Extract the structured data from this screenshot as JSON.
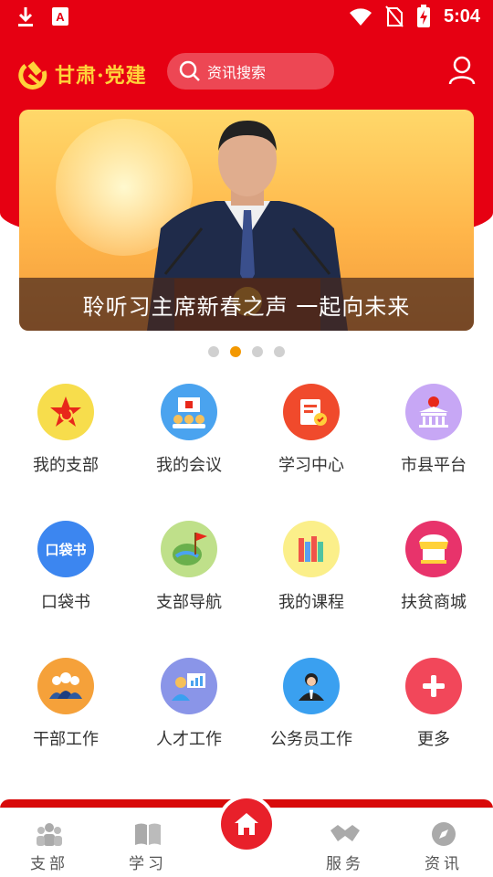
{
  "status_bar": {
    "time": "5:04"
  },
  "header": {
    "brand_name": "甘肃·党建",
    "search_placeholder": "资讯搜索"
  },
  "banner": {
    "caption": "聆听习主席新春之声 一起向未来",
    "slide_count": 4,
    "active_slide": 2
  },
  "grid_items": [
    {
      "label": "我的支部",
      "icon": "party-star-icon",
      "color": "#f7dd4c"
    },
    {
      "label": "我的会议",
      "icon": "meeting-icon",
      "color": "#4aa3ef"
    },
    {
      "label": "学习中心",
      "icon": "study-center-icon",
      "color": "#f04a2c"
    },
    {
      "label": "市县平台",
      "icon": "government-building-icon",
      "color": "#c7a7f5"
    },
    {
      "label": "口袋书",
      "icon": "pocket-book-icon",
      "color": "#3c86f0"
    },
    {
      "label": "支部导航",
      "icon": "map-flag-icon",
      "color": "#bfe08a"
    },
    {
      "label": "我的课程",
      "icon": "books-icon",
      "color": "#fbef8a"
    },
    {
      "label": "扶贫商城",
      "icon": "shop-stall-icon",
      "color": "#e8336b"
    },
    {
      "label": "干部工作",
      "icon": "cadres-icon",
      "color": "#f5a13a"
    },
    {
      "label": "人才工作",
      "icon": "talent-presentation-icon",
      "color": "#8a95e8"
    },
    {
      "label": "公务员工作",
      "icon": "civil-servant-icon",
      "color": "#3aa0f0"
    },
    {
      "label": "更多",
      "icon": "plus-icon",
      "color": "#f2475a"
    }
  ],
  "pocket_book_icon_text": "口袋书",
  "tabbar": {
    "tabs": [
      {
        "label": "支部",
        "icon": "people-icon"
      },
      {
        "label": "学习",
        "icon": "open-book-icon"
      },
      {
        "label": "服务",
        "icon": "handshake-icon"
      },
      {
        "label": "资讯",
        "icon": "compass-icon"
      }
    ],
    "home_icon": "home-icon"
  },
  "colors": {
    "brand_red": "#e60012",
    "accent_orange": "#f39800",
    "logo_gold": "#ffd23a"
  }
}
